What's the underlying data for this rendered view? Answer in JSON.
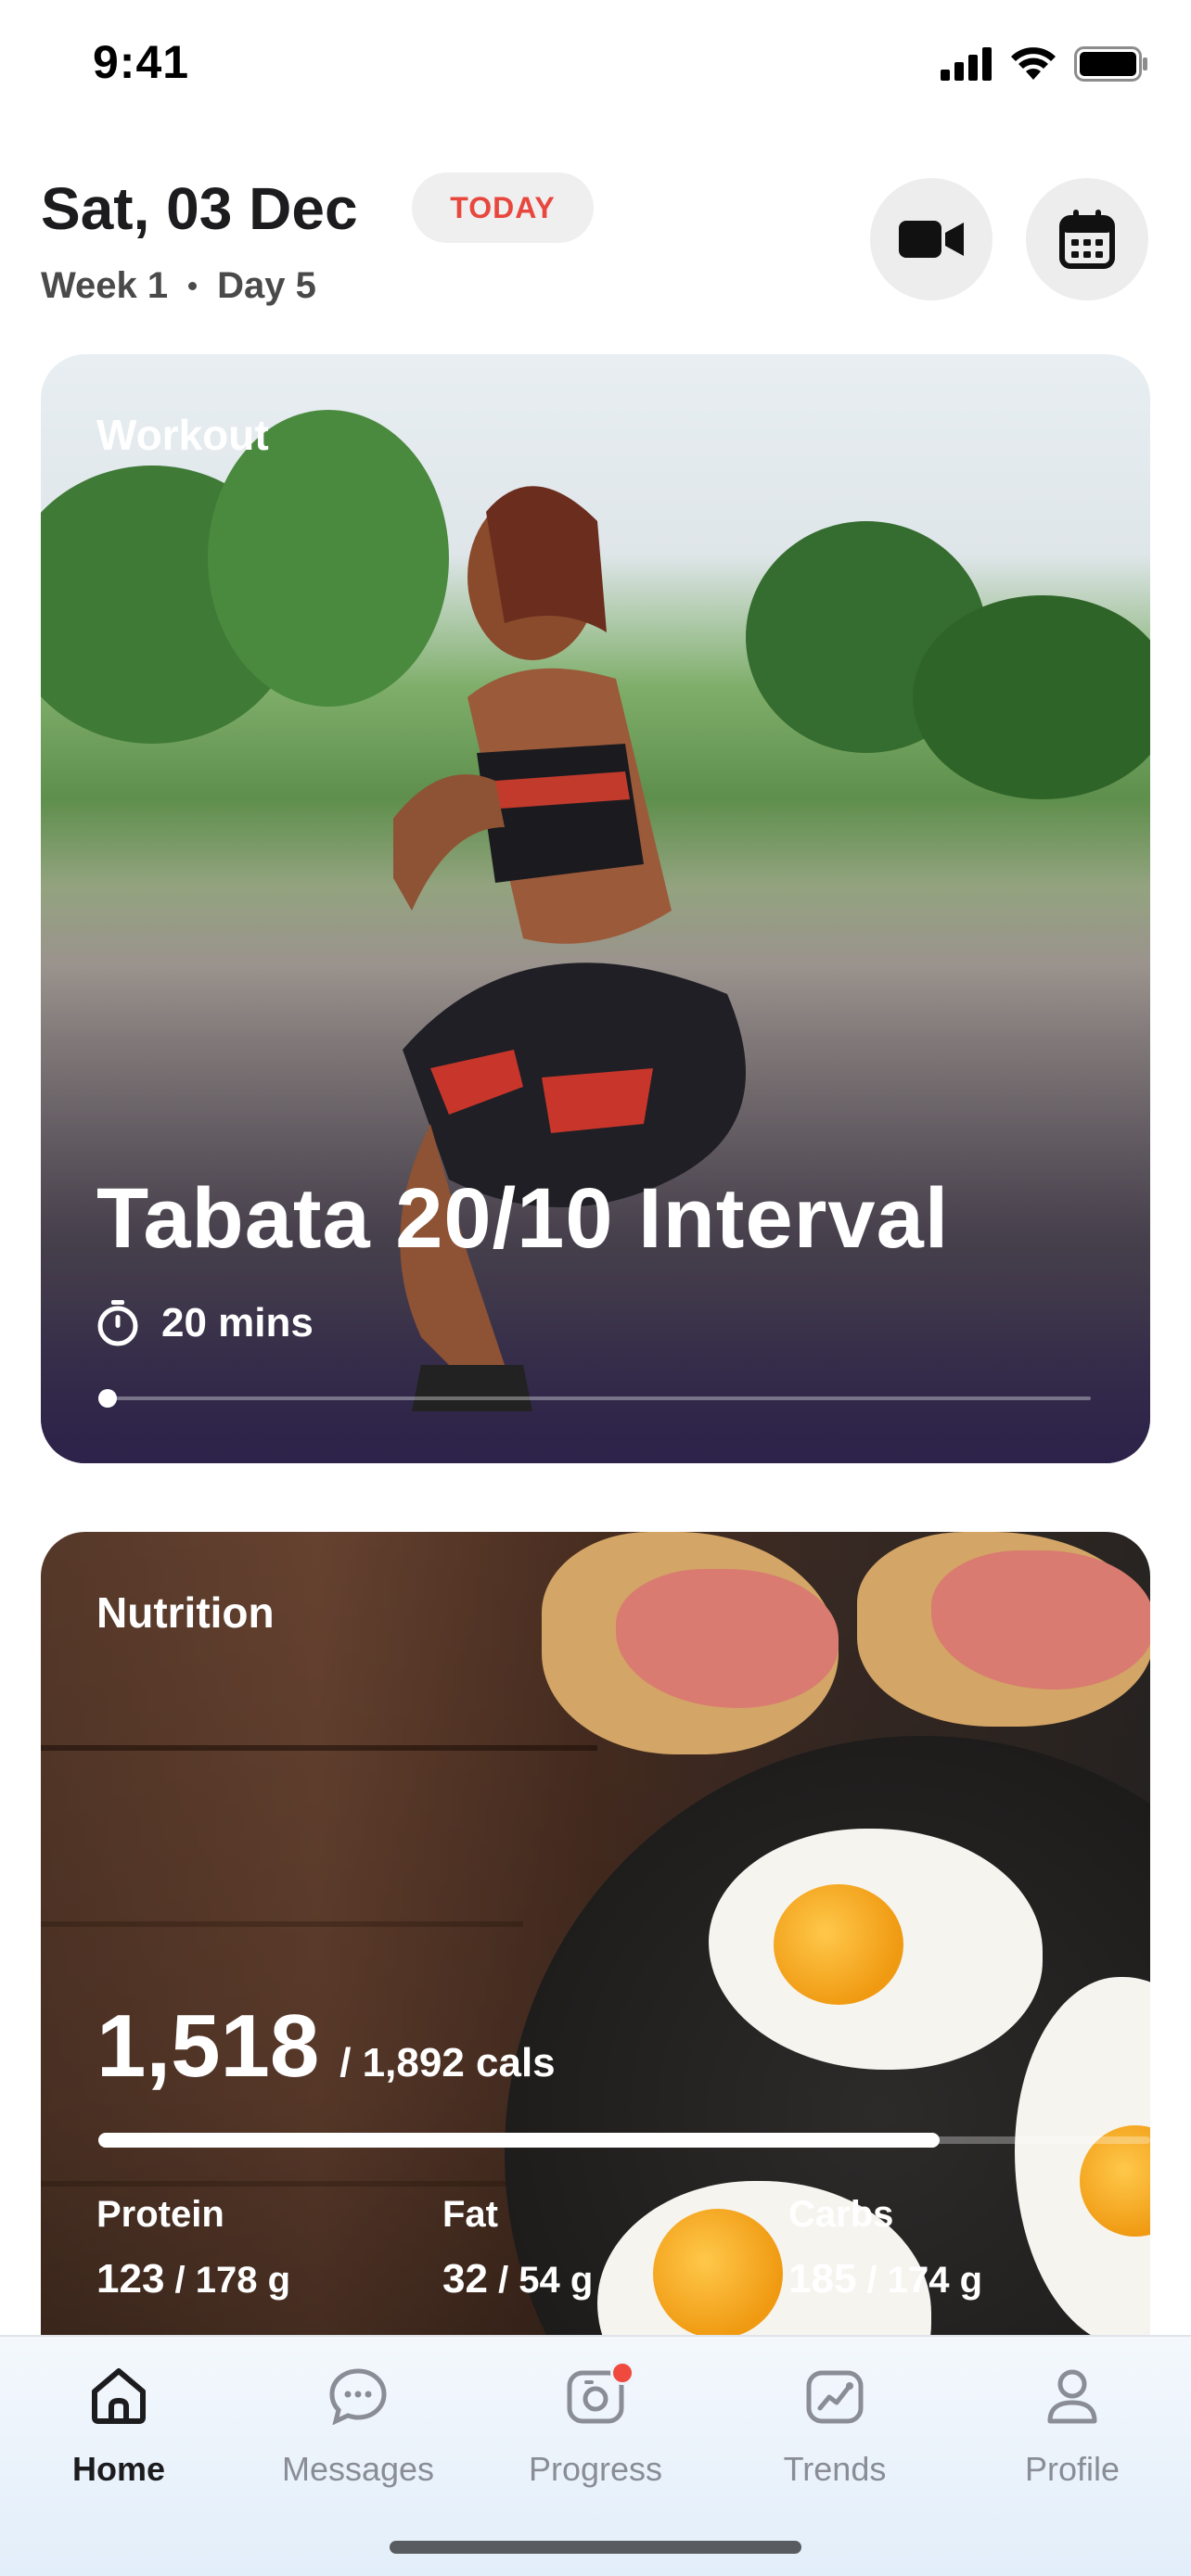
{
  "status_bar": {
    "time": "9:41"
  },
  "header": {
    "date": "Sat, 03 Dec",
    "badge": "TODAY",
    "week": "Week 1",
    "day": "Day 5",
    "video_icon": "video-camera-icon",
    "calendar_icon": "calendar-icon"
  },
  "workout": {
    "label": "Workout",
    "title": "Tabata 20/10 Interval",
    "duration": "20 mins",
    "progress": 0
  },
  "nutrition": {
    "label": "Nutrition",
    "calories": "1,518",
    "calories_goal": "/ 1,892 cals",
    "calories_fraction": 0.8,
    "macros": [
      {
        "label": "Protein",
        "value": "123",
        "goal": "/ 178 g"
      },
      {
        "label": "Fat",
        "value": "32",
        "goal": "/ 54 g"
      },
      {
        "label": "Carbs",
        "value": "185",
        "goal": "/ 174 g"
      }
    ]
  },
  "tabs": [
    {
      "label": "Home",
      "icon": "home-icon",
      "active": true
    },
    {
      "label": "Messages",
      "icon": "chat-bubble-icon",
      "active": false
    },
    {
      "label": "Progress",
      "icon": "camera-progress-icon",
      "active": false,
      "notification": true
    },
    {
      "label": "Trends",
      "icon": "trend-chart-icon",
      "active": false
    },
    {
      "label": "Profile",
      "icon": "person-icon",
      "active": false
    }
  ],
  "colors": {
    "accent_red": "#e8473e",
    "notification": "#f0493e",
    "text_dark": "#1c1c1e",
    "tab_inactive": "#8a8d96"
  }
}
